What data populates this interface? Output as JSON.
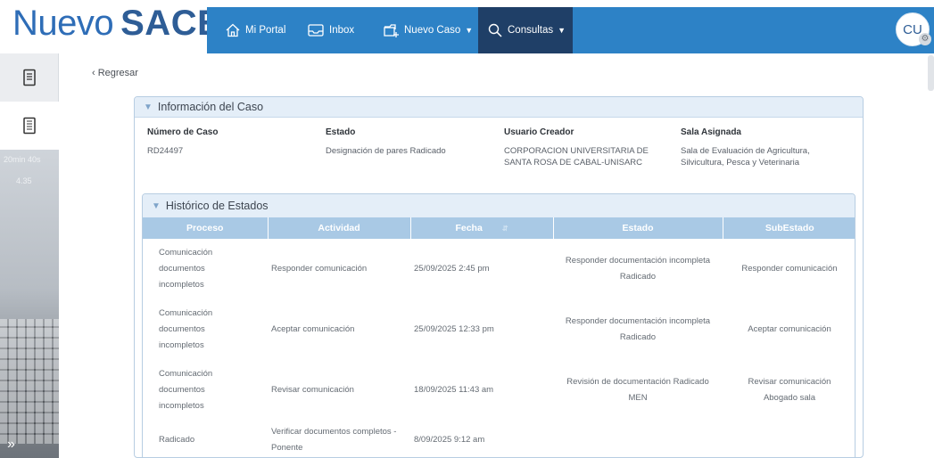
{
  "logo": {
    "word1": "Nuevo",
    "word2": "SACES"
  },
  "nav": {
    "items": [
      {
        "label": "Mi Portal",
        "icon": "home-icon"
      },
      {
        "label": "Inbox",
        "icon": "inbox-icon"
      },
      {
        "label": "Nuevo Caso",
        "icon": "new-case-icon",
        "dropdown": true
      },
      {
        "label": "Consultas",
        "icon": "search-icon",
        "dropdown": true,
        "active": true
      }
    ]
  },
  "user": {
    "initials": "CU"
  },
  "left_sidebar": {
    "icons": [
      "document-icon",
      "document-list-icon"
    ],
    "ghost_text": [
      "20min 40s",
      "4.35"
    ],
    "expand": "»"
  },
  "back_link": "‹ Regresar",
  "case_info": {
    "title": "Información del Caso",
    "fields": [
      {
        "label": "Número de Caso",
        "value": "RD24497"
      },
      {
        "label": "Estado",
        "value": "Designación de pares Radicado"
      },
      {
        "label": "Usuario Creador",
        "value_lines": [
          "CORPORACION UNIVERSITARIA DE",
          "SANTA ROSA DE CABAL-UNISARC"
        ]
      },
      {
        "label": "Sala Asignada",
        "value_lines": [
          "Sala de Evaluación de Agricultura,",
          "Silvicultura, Pesca y Veterinaria"
        ]
      }
    ]
  },
  "history": {
    "title": "Histórico de Estados",
    "columns": [
      "Proceso",
      "Actividad",
      "Fecha",
      "Estado",
      "SubEstado"
    ],
    "rows": [
      {
        "proceso": [
          "Comunicación",
          "documentos",
          "incompletos"
        ],
        "actividad": [
          "Responder comunicación"
        ],
        "fecha": "25/09/2025 2:45 pm",
        "estado": [
          "Responder documentación incompleta",
          "Radicado"
        ],
        "subestado": [
          "Responder comunicación"
        ]
      },
      {
        "proceso": [
          "Comunicación",
          "documentos",
          "incompletos"
        ],
        "actividad": [
          "Aceptar comunicación"
        ],
        "fecha": "25/09/2025 12:33 pm",
        "estado": [
          "Responder documentación incompleta",
          "Radicado"
        ],
        "subestado": [
          "Aceptar comunicación"
        ]
      },
      {
        "proceso": [
          "Comunicación",
          "documentos",
          "incompletos"
        ],
        "actividad": [
          "Revisar comunicación"
        ],
        "fecha": "18/09/2025 11:43 am",
        "estado": [
          "Revisión de documentación Radicado",
          "MEN"
        ],
        "subestado": [
          "Revisar comunicación",
          "Abogado sala"
        ]
      },
      {
        "proceso": [
          "Radicado"
        ],
        "actividad": [
          "Verificar documentos completos -",
          "Ponente"
        ],
        "fecha": "8/09/2025 9:12 am",
        "estado": [],
        "subestado": []
      }
    ]
  },
  "colors": {
    "nav_bg": "#2d82c6",
    "nav_active": "#1f3f67",
    "table_header": "#a9c9e5",
    "panel_header": "#e4eef8",
    "logo_blue": "#2e6db7"
  }
}
